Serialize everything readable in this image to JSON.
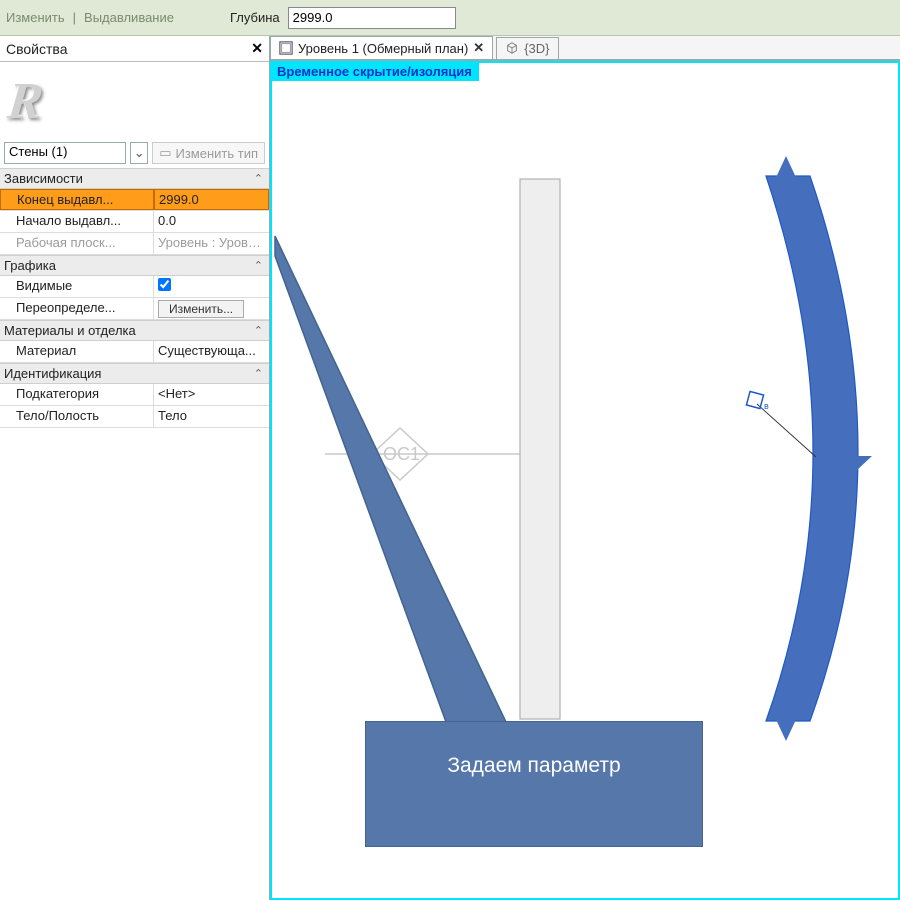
{
  "topbar": {
    "modify": "Изменить",
    "extrusion": "Выдавливание",
    "depth_label": "Глубина",
    "depth_value": "2999.0"
  },
  "properties": {
    "title": "Свойства",
    "type_selector": "Стены (1)",
    "edit_type": "Изменить тип"
  },
  "groups": {
    "constraints": {
      "title": "Зависимости",
      "rows": [
        {
          "label": "Конец выдавл...",
          "value": "2999.0",
          "highlight": true
        },
        {
          "label": "Начало выдавл...",
          "value": "0.0"
        },
        {
          "label": "Рабочая плоск...",
          "value": "Уровень : Урове...",
          "disabled": true
        }
      ]
    },
    "graphics": {
      "title": "Графика",
      "rows": [
        {
          "label": "Видимые",
          "value_check": true
        },
        {
          "label": "Переопределе...",
          "value_btn": "Изменить..."
        }
      ]
    },
    "materials": {
      "title": "Материалы и отделка",
      "rows": [
        {
          "label": "Материал",
          "value": "Существующа..."
        }
      ]
    },
    "identity": {
      "title": "Идентификация",
      "rows": [
        {
          "label": "Подкатегория",
          "value": "<Нет>"
        },
        {
          "label": "Тело/Полость",
          "value": "Тело"
        }
      ]
    }
  },
  "tabs": {
    "active": "Уровень 1 (Обмерный план)",
    "inactive": "{3D}"
  },
  "canvas": {
    "temp_hide": "Временное скрытие/изоляция",
    "axis_label": "ОС1"
  },
  "callout": {
    "text": "Задаем параметр"
  }
}
